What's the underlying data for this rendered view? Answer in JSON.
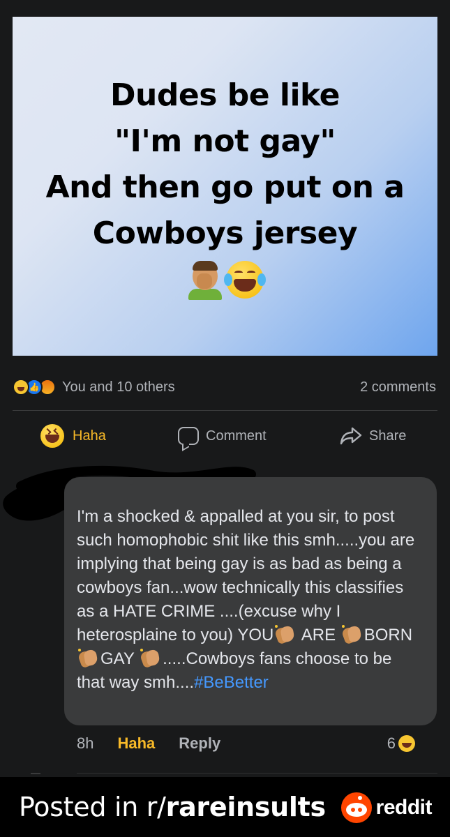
{
  "post": {
    "meme_lines": [
      "Dudes be like",
      "\"I'm not gay\"",
      "And then go put on a",
      "Cowboys jersey"
    ],
    "meme_emojis": [
      "facepalm-emoji",
      "laughing-crying-emoji"
    ],
    "background_colors": [
      "#6ea5ee",
      "#e2e8f3"
    ]
  },
  "reactions": {
    "icons": [
      "haha-icon",
      "like-icon",
      "angry-icon"
    ],
    "summary": "You and 10 others",
    "comments": "2 comments"
  },
  "actions": {
    "haha": "Haha",
    "comment": "Comment",
    "share": "Share"
  },
  "comment": {
    "author_redacted": true,
    "text_parts": [
      "I'm a shocked & appalled at you sir, to post such homophobic shit like this smh.....you are implying that being gay is as bad as being a cowboys fan...wow technically this classifies as a HATE CRIME ....(excuse why I heterosplaine to you) YOU",
      " ARE ",
      "BORN ",
      "GAY ",
      ".....Cowboys fans choose to be that way smh...."
    ],
    "hashtag": "#BeBetter",
    "time": "8h",
    "haha_label": "Haha",
    "reply_label": "Reply",
    "reaction_count": "6"
  },
  "footer": {
    "posted_in": "Posted in r/",
    "subreddit": "rareinsults",
    "brand": "reddit"
  },
  "colors": {
    "background": "#18191a",
    "comment_bubble": "#3a3b3c",
    "haha_accent": "#f7b928",
    "hashtag": "#4599ff",
    "reddit_orange": "#ff4500"
  }
}
